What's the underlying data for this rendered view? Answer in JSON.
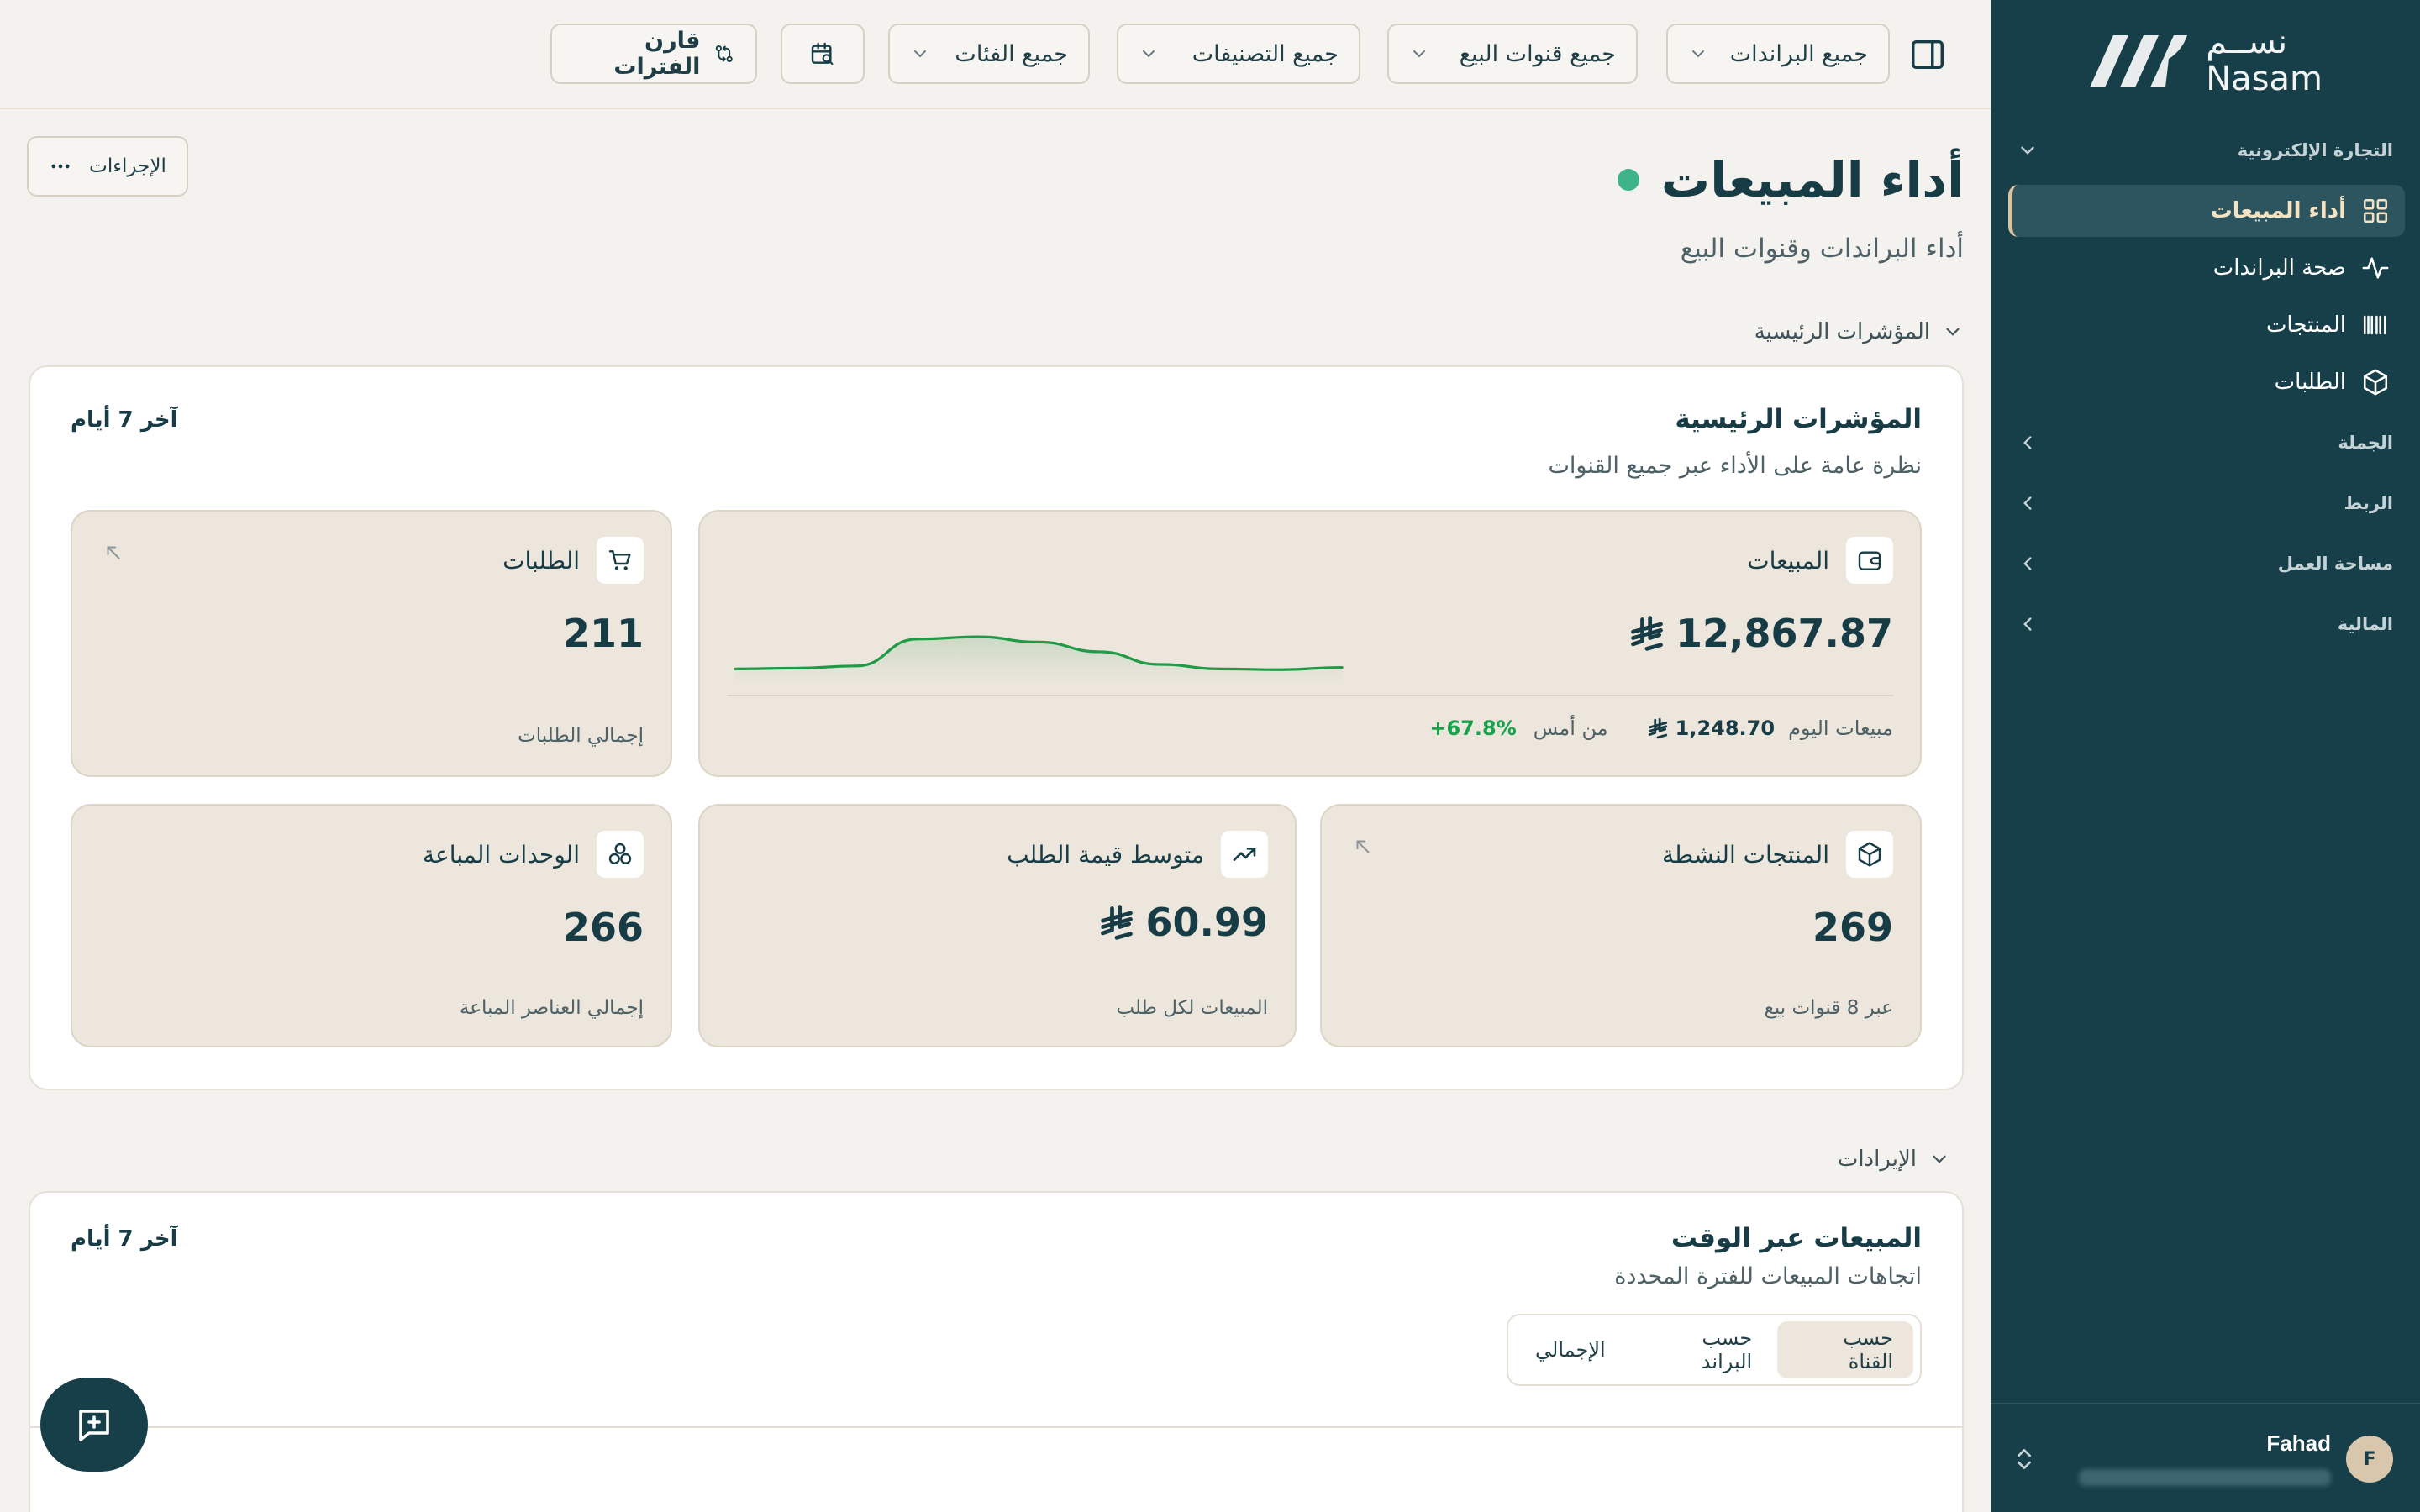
{
  "brand": {
    "name_ar": "نســم",
    "name_en": "Nasam"
  },
  "sidebar": {
    "groups": [
      {
        "label": "التجارة الإلكترونية"
      },
      {
        "label": "الجملة"
      },
      {
        "label": "الربط"
      },
      {
        "label": "مساحة العمل"
      },
      {
        "label": "المالية"
      }
    ],
    "items": [
      {
        "label": "أداء المبيعات",
        "icon": "dashboard-icon",
        "active": true
      },
      {
        "label": "صحة البراندات",
        "icon": "activity-icon"
      },
      {
        "label": "المنتجات",
        "icon": "barcode-icon"
      },
      {
        "label": "الطلبات",
        "icon": "package-icon"
      }
    ],
    "user": {
      "initial": "F",
      "name": "Fahad"
    }
  },
  "topbar": {
    "filters": {
      "brands": "جميع البراندات",
      "channels": "جميع قنوات البيع",
      "classifications": "جميع التصنيفات",
      "categories": "جميع الفئات"
    },
    "compare_label": "قارن الفترات"
  },
  "page": {
    "title": "أداء المبيعات",
    "subtitle": "أداء البراندات وقنوات البيع",
    "actions_label": "الإجراءات"
  },
  "kpi_section": {
    "toggle_label": "المؤشرات الرئيسية",
    "title": "المؤشرات الرئيسية",
    "subtitle": "نظرة عامة على الأداء عبر جميع القنوات",
    "period": "آخر 7 أيام",
    "sales": {
      "label": "المبيعات",
      "value": "12,867.87",
      "today_label": "مبيعات اليوم",
      "today_value": "1,248.70",
      "compare_label": "من أمس",
      "change": "+67.8%",
      "sparkline": [
        0.12,
        0.13,
        0.16,
        0.52,
        0.55,
        0.48,
        0.35,
        0.18,
        0.12,
        0.11,
        0.14
      ]
    },
    "orders": {
      "label": "الطلبات",
      "value": "211",
      "note": "إجمالي الطلبات"
    },
    "active_products": {
      "label": "المنتجات النشطة",
      "value": "269",
      "note": "عبر 8 قنوات بيع"
    },
    "avg_order": {
      "label": "متوسط قيمة الطلب",
      "value": "60.99",
      "note": "المبيعات لكل طلب"
    },
    "units_sold": {
      "label": "الوحدات المباعة",
      "value": "266",
      "note": "إجمالي العناصر المباعة"
    }
  },
  "revenue_section": {
    "toggle_label": "الإيرادات",
    "title": "المبيعات عبر الوقت",
    "subtitle": "اتجاهات المبيعات للفترة المحددة",
    "period": "آخر 7 أيام",
    "tabs": [
      "حسب القناة",
      "حسب البراند",
      "الإجمالي"
    ]
  },
  "colors": {
    "sidebar_bg": "#173f49",
    "accent_active": "#d9c3a1",
    "status_dot": "#3fb389",
    "positive": "#18a24e",
    "sparkline": "#1f9a45"
  }
}
